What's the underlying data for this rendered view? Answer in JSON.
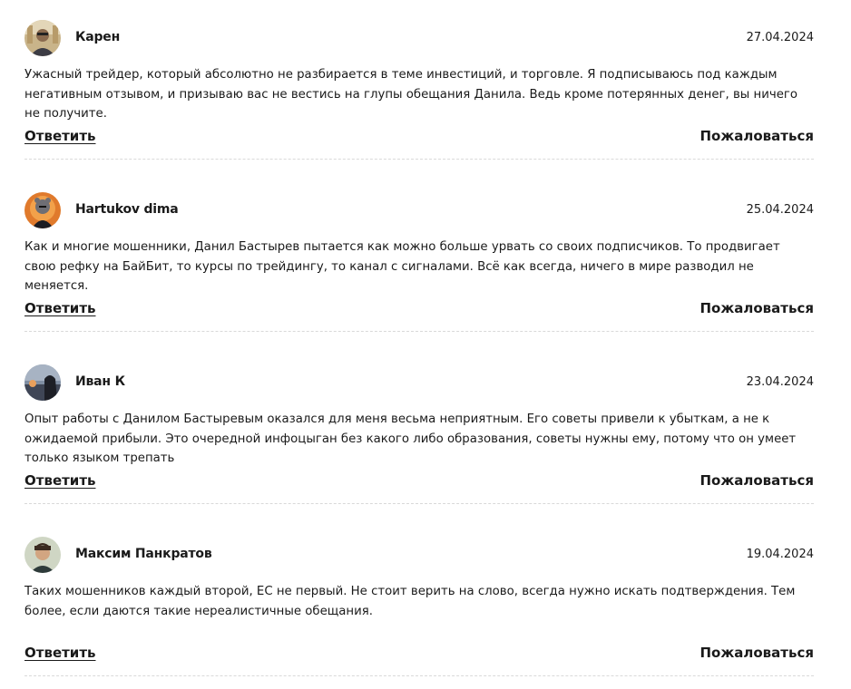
{
  "comments": [
    {
      "author": "Карен",
      "date": "27.04.2024",
      "text": "Ужасный трейдер, который абсолютно не разбирается в теме инвестиций, и торговле. Я подписываюсь под каждым негативным отзывом, и призываю вас не вестись на глупы обещания Данила. Ведь кроме потерянных денег, вы ничего не получите.",
      "reply_label": "Ответить",
      "report_label": "Пожаловаться"
    },
    {
      "author": "Hartukov dima",
      "date": "25.04.2024",
      "text": "Как и многие мошенники, Данил Бастырев пытается как можно больше урвать со своих подписчиков. То продвигает свою рефку на БайБит, то курсы по трейдингу, то канал с сигналами. Всё как всегда, ничего в мире разводил не меняется.",
      "reply_label": "Ответить",
      "report_label": "Пожаловаться"
    },
    {
      "author": "Иван К",
      "date": "23.04.2024",
      "text": "Опыт работы с Данилом Бастыревым оказался для меня весьма неприятным. Его советы привели к убыткам, а не к ожидаемой прибыли. Это очередной инфоцыган без какого либо образования, советы нужны ему, потому что он умеет только языком трепать",
      "reply_label": "Ответить",
      "report_label": "Пожаловаться"
    },
    {
      "author": "Максим Панкратов",
      "date": "19.04.2024",
      "text": "Таких мошенников каждый второй, ЕС не первый. Не стоит верить на слово, всегда нужно искать подтверждения. Тем более, если даются такие нереалистичные обещания.",
      "reply_label": "Ответить",
      "report_label": "Пожаловаться"
    }
  ],
  "colors": {
    "text": "#1a1a1a",
    "divider": "#d9d9d9",
    "background": "#ffffff"
  }
}
